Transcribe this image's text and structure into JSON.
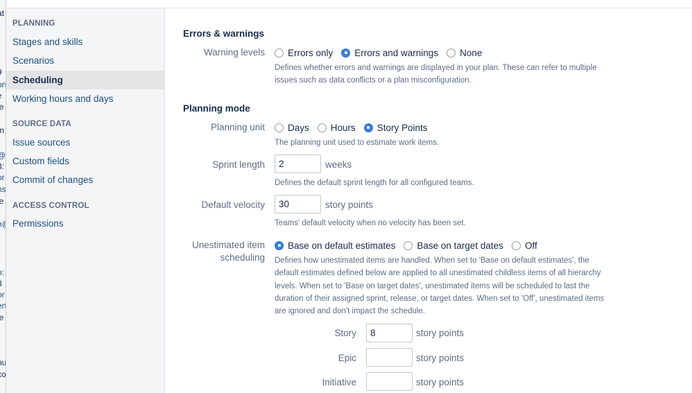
{
  "bg_strip": {
    "fragments": [
      {
        "text": "at",
        "link": false
      },
      {
        "text": "9",
        "link": false
      },
      {
        "text": "on",
        "link": true
      },
      {
        "text": "e",
        "link": true
      },
      {
        "text": "ie",
        "link": false
      },
      {
        "text": "m",
        "link": false
      },
      {
        "text": "@",
        "link": true
      },
      {
        "text": "3:",
        "link": false
      },
      {
        "text": "or",
        "link": true
      },
      {
        "text": "ns",
        "link": true
      },
      {
        "text": "ie",
        "link": false
      },
      {
        "text": "n@",
        "link": true
      },
      {
        "text": "o:",
        "link": true
      },
      {
        "text": "3",
        "link": false
      },
      {
        "text": "or",
        "link": true
      },
      {
        "text": "en",
        "link": true
      },
      {
        "text": "ie",
        "link": false
      },
      {
        "text": "nu",
        "link": false
      },
      {
        "text": "xo",
        "link": false
      }
    ]
  },
  "sidebar": {
    "sections": [
      {
        "heading": "PLANNING",
        "items": [
          "Stages and skills",
          "Scenarios",
          "Scheduling",
          "Working hours and days"
        ]
      },
      {
        "heading": "SOURCE DATA",
        "items": [
          "Issue sources",
          "Custom fields",
          "Commit of changes"
        ]
      },
      {
        "heading": "ACCESS CONTROL",
        "items": [
          "Permissions"
        ]
      }
    ],
    "active_item": "Scheduling"
  },
  "errors_warnings": {
    "title": "Errors & warnings",
    "label": "Warning levels",
    "options": [
      "Errors only",
      "Errors and warnings",
      "None"
    ],
    "selected": "Errors and warnings",
    "help": "Defines whether errors and warnings are displayed in your plan. These can refer to multiple issues such as data conflicts or a plan misconfiguration."
  },
  "planning_mode": {
    "title": "Planning mode",
    "planning_unit": {
      "label": "Planning unit",
      "options": [
        "Days",
        "Hours",
        "Story Points"
      ],
      "selected": "Story Points",
      "help": "The planning unit used to estimate work items."
    },
    "sprint_length": {
      "label": "Sprint length",
      "value": "2",
      "unit": "weeks",
      "help": "Defines the default sprint length for all configured teams."
    },
    "default_velocity": {
      "label": "Default velocity",
      "value": "30",
      "unit": "story points",
      "help": "Teams' default velocity when no velocity has been set."
    },
    "unestimated": {
      "label_line1": "Unestimated item",
      "label_line2": "scheduling",
      "options": [
        "Base on default estimates",
        "Base on target dates",
        "Off"
      ],
      "selected": "Base on default estimates",
      "help": "Defines how unestimated items are handled. When set to 'Base on default estimates', the default estimates defined below are applied to all unestimated childless items of all hierarchy levels. When set to 'Base on target dates', unestimated items will be scheduled to last the duration of their assigned sprint, release, or target dates. When set to 'Off', unestimated items are ignored and don't impact the schedule."
    },
    "estimates": [
      {
        "label": "Story",
        "value": "8",
        "unit": "story points"
      },
      {
        "label": "Epic",
        "value": "",
        "unit": "story points"
      },
      {
        "label": "Initiative",
        "value": "",
        "unit": "story points"
      }
    ]
  }
}
